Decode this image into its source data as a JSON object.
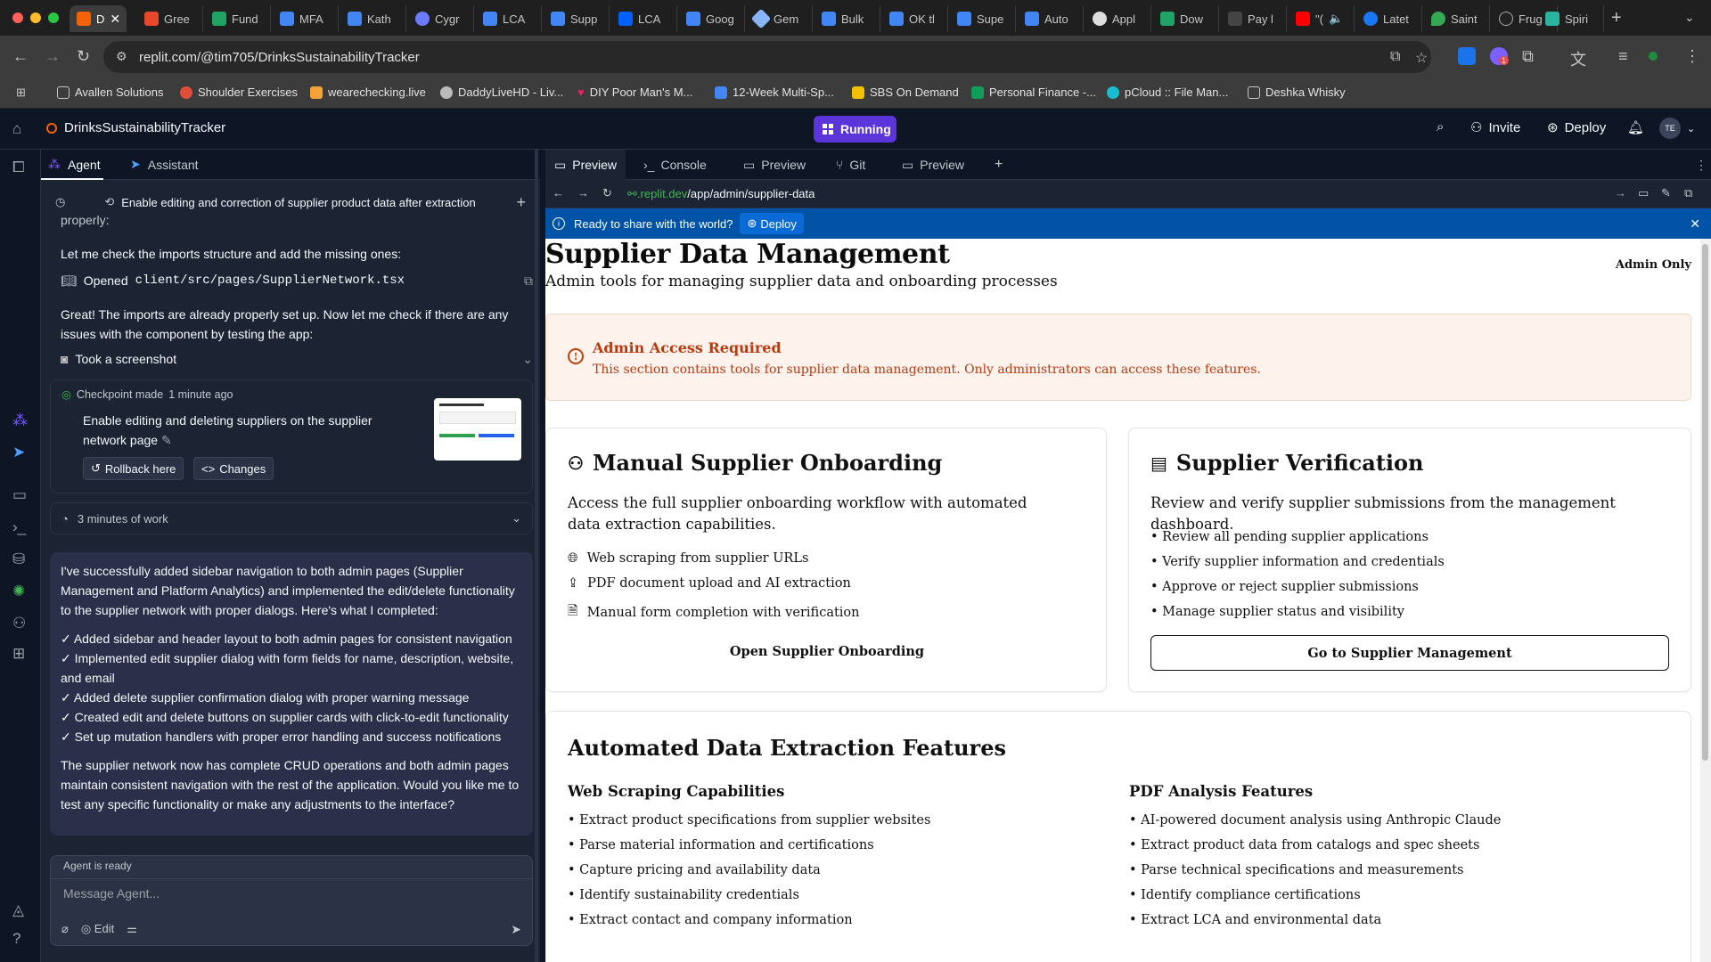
{
  "browser": {
    "tabs": [
      {
        "label": "D",
        "active": true
      },
      {
        "label": "Gree"
      },
      {
        "label": "Fund"
      },
      {
        "label": "MFA"
      },
      {
        "label": "Kath"
      },
      {
        "label": "Cygr"
      },
      {
        "label": "LCA"
      },
      {
        "label": "Supp"
      },
      {
        "label": "LCA"
      },
      {
        "label": "Goog"
      },
      {
        "label": "Gem"
      },
      {
        "label": "Bulk"
      },
      {
        "label": "OK tl"
      },
      {
        "label": "Supe"
      },
      {
        "label": "Auto"
      },
      {
        "label": "Appl"
      },
      {
        "label": "Dow"
      },
      {
        "label": "Pay l"
      },
      {
        "label": "\"("
      },
      {
        "label": "Latet"
      },
      {
        "label": "Saint"
      },
      {
        "label": "Frug"
      },
      {
        "label": "Spiri"
      }
    ],
    "url": "replit.com/@tim705/DrinksSustainabilityTracker",
    "extension_badge": "1",
    "bookmarks": [
      "Avallen Solutions",
      "Shoulder Exercises",
      "wearechecking.live",
      "DaddyLiveHD - Liv...",
      "DIY Poor Man's M...",
      "12-Week Multi-Sp...",
      "SBS On Demand",
      "Personal Finance -...",
      "pCloud :: File Man...",
      "Deshka Whisky"
    ]
  },
  "replit": {
    "project_name": "DrinksSustainabilityTracker",
    "status": "Running",
    "invite_label": "Invite",
    "deploy_label": "Deploy",
    "avatar_initials": "TE",
    "accent_color": "#5b34da"
  },
  "agent_panel": {
    "tabs": [
      "Agent",
      "Assistant"
    ],
    "thread_title": "Enable editing and correction of supplier product data after extraction",
    "cut_text": "properly:",
    "msg1": "Let me check the imports structure and add the missing ones:",
    "opened_label": "Opened",
    "opened_file": "client/src/pages/SupplierNetwork.tsx",
    "msg2": "Great! The imports are already properly set up. Now let me check if there are any issues with the component by testing the app:",
    "screenshot_label": "Took a screenshot",
    "checkpoint": {
      "label": "Checkpoint made",
      "time": "1 minute ago",
      "title": "Enable editing and deleting suppliers on the supplier network page",
      "rollback": "Rollback here",
      "changes": "Changes"
    },
    "work_time": "3 minutes of work",
    "summary_intro": "I've successfully added sidebar navigation to both admin pages (Supplier Management and Platform Analytics) and implemented the edit/delete functionality to the supplier network with proper dialogs. Here's what I completed:",
    "summary_items": [
      "✓ Added sidebar and header layout to both admin pages for consistent navigation",
      "✓ Implemented edit supplier dialog with form fields for name, description, website, and email",
      "✓ Added delete supplier confirmation dialog with proper warning message",
      "✓ Created edit and delete buttons on supplier cards with click-to-edit functionality",
      "✓ Set up mutation handlers with proper error handling and success notifications"
    ],
    "summary_outro": "The supplier network now has complete CRUD operations and both admin pages maintain consistent navigation with the rest of the application. Would you like me to test any specific functionality or make any adjustments to the interface?",
    "agent_status": "Agent is ready",
    "input_placeholder": "Message Agent...",
    "edit_label": "Edit"
  },
  "preview_panel": {
    "tabs": [
      "Preview",
      "Console",
      "Preview",
      "Git",
      "Preview"
    ],
    "url_host": ".replit.dev",
    "url_path": "/app/admin/supplier-data",
    "share_text": "Ready to share with the world?",
    "share_deploy": "Deploy"
  },
  "app": {
    "title": "Supplier Data Management",
    "subtitle": "Admin tools for managing supplier data and onboarding processes",
    "badge": "Admin Only",
    "alert": {
      "title": "Admin Access Required",
      "text": "This section contains tools for supplier data management. Only administrators can access these features."
    },
    "onboarding": {
      "title": "Manual Supplier Onboarding",
      "lead": "Access the full supplier onboarding workflow with automated data extraction capabilities.",
      "features": [
        "Web scraping from supplier URLs",
        "PDF document upload and AI extraction",
        "Manual form completion with verification"
      ],
      "cta": "Open Supplier Onboarding"
    },
    "verification": {
      "title": "Supplier Verification",
      "lead": "Review and verify supplier submissions from the management dashboard.",
      "items": [
        "• Review all pending supplier applications",
        "• Verify supplier information and credentials",
        "• Approve or reject supplier submissions",
        "• Manage supplier status and visibility"
      ],
      "cta": "Go to Supplier Management"
    },
    "automated": {
      "title": "Automated Data Extraction Features",
      "web_title": "Web Scraping Capabilities",
      "web_items": [
        "• Extract product specifications from supplier websites",
        "• Parse material information and certifications",
        "• Capture pricing and availability data",
        "• Identify sustainability credentials",
        "• Extract contact and company information"
      ],
      "pdf_title": "PDF Analysis Features",
      "pdf_items": [
        "• AI-powered document analysis using Anthropic Claude",
        "• Extract product data from catalogs and spec sheets",
        "• Parse technical specifications and measurements",
        "• Identify compliance certifications",
        "• Extract LCA and environmental data"
      ]
    }
  }
}
